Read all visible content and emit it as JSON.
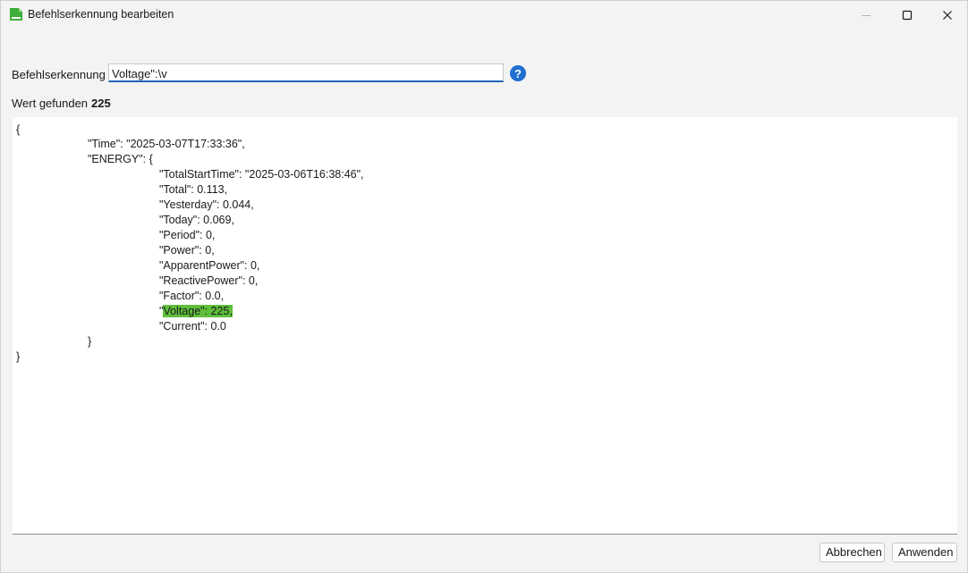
{
  "window": {
    "title": "Befehlserkennung bearbeiten"
  },
  "icons": {
    "app": "app-logo-icon",
    "minimize": "minimize-icon",
    "maximize": "maximize-icon",
    "close": "close-icon",
    "help": "help-icon"
  },
  "form": {
    "command_label": "Befehlserkennung",
    "command_value": "Voltage\":\\v",
    "help_glyph": "?",
    "found_label": "Wert gefunden",
    "found_value": "225"
  },
  "json_view": {
    "lines": [
      "{",
      "\"Time\": \"2025-03-07T17:33:36\",",
      "\"ENERGY\": {",
      "\"TotalStartTime\": \"2025-03-06T16:38:46\",",
      "\"Total\": 0.113,",
      "\"Yesterday\": 0.044,",
      "\"Today\": 0.069,",
      "\"Period\": 0,",
      "\"Power\": 0,",
      "\"ApparentPower\": 0,",
      "\"ReactivePower\": 0,",
      "\"Factor\": 0.0,",
      "\"",
      "Voltage\": 225,",
      "\"Current\": 0.0",
      "}",
      "}"
    ]
  },
  "buttons": {
    "cancel": "Abbrechen",
    "apply": "Anwenden"
  },
  "colors": {
    "accent": "#1e63b8",
    "highlight": "#5fbf3c",
    "help": "#1f6fcf"
  }
}
